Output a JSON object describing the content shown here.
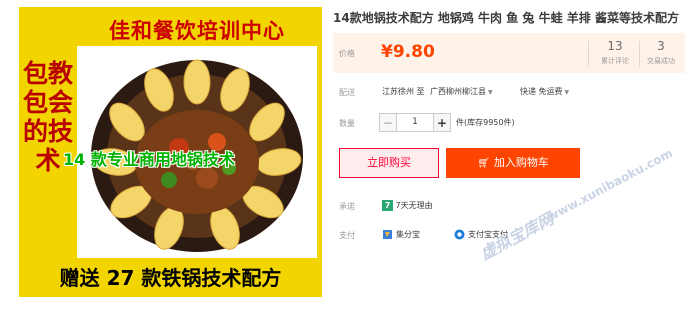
{
  "image": {
    "title": "佳和餐饮培训中心",
    "side_text": "包教包会的技术",
    "overlay": "14 款专业商用地锅技术",
    "bottom": "赠送 27 款铁锅技术配方"
  },
  "product": {
    "title": "14款地锅技术配方 地锅鸡 牛肉 鱼 兔 牛蛙 羊排 酱菜等技术配方"
  },
  "price": {
    "label": "价格",
    "currency": "¥",
    "amount": "9.80",
    "color": "#ff4400"
  },
  "stats": [
    {
      "value": "13",
      "label": "累计评论"
    },
    {
      "value": "3",
      "label": "交易成功"
    }
  ],
  "shipping": {
    "label": "配送",
    "from": "江苏徐州 至",
    "to": "广西柳州柳江县",
    "method": "快递 免运费"
  },
  "quantity": {
    "label": "数量",
    "minus": "−",
    "value": "1",
    "plus": "+",
    "stock": "件(库存9950件)"
  },
  "actions": {
    "buy_now": "立即购买",
    "add_cart": "加入购物车"
  },
  "service": {
    "label": "承诺",
    "badge": "7",
    "text": "7天无理由"
  },
  "payment": {
    "label": "支付",
    "methods": [
      "集分宝",
      "支付宝支付"
    ]
  },
  "watermark": {
    "url": "www.xunibaoku.com",
    "name": "虚拟宝库网"
  },
  "colors": {
    "accent": "#ff4400",
    "image_bg": "#f2d400",
    "price_bg": "#fff2e8"
  }
}
